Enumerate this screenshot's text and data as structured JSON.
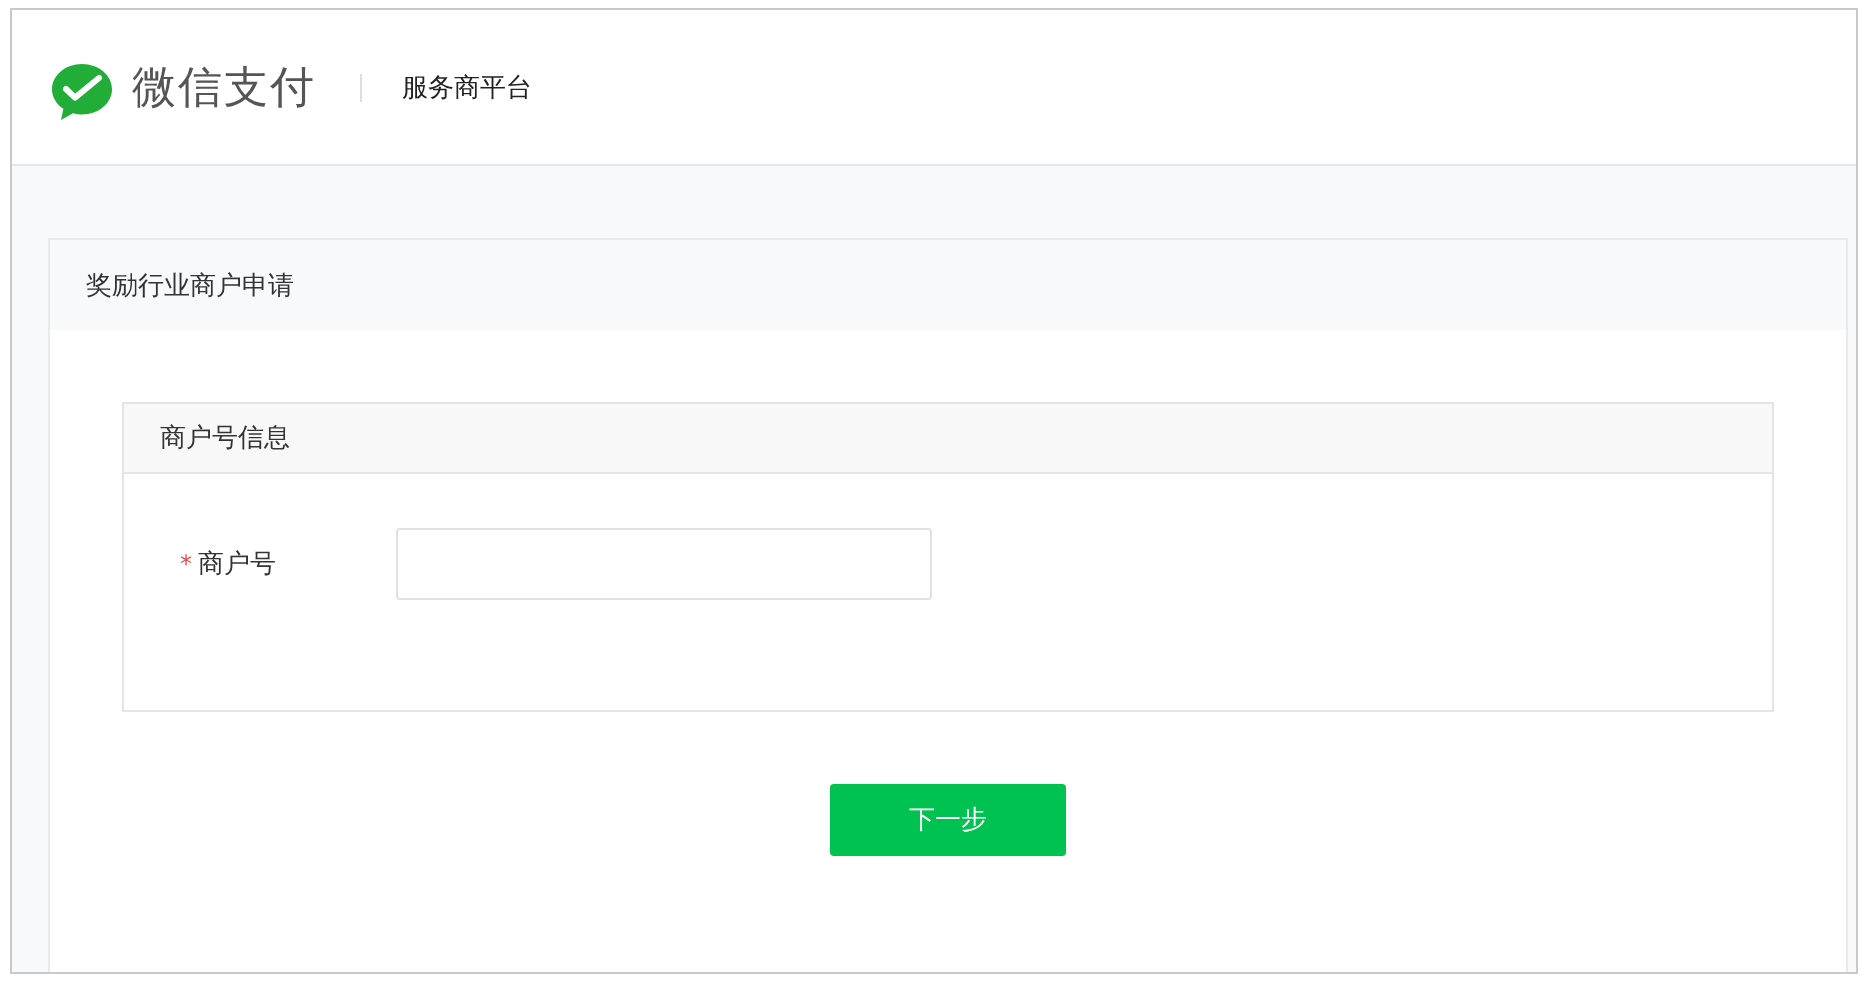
{
  "header": {
    "brand": "微信支付",
    "platform": "服务商平台"
  },
  "panel": {
    "title": "奖励行业商户申请"
  },
  "section": {
    "title": "商户号信息"
  },
  "fields": [
    {
      "required_mark": "*",
      "label": "商户号"
    }
  ],
  "next_button": "下一步"
}
